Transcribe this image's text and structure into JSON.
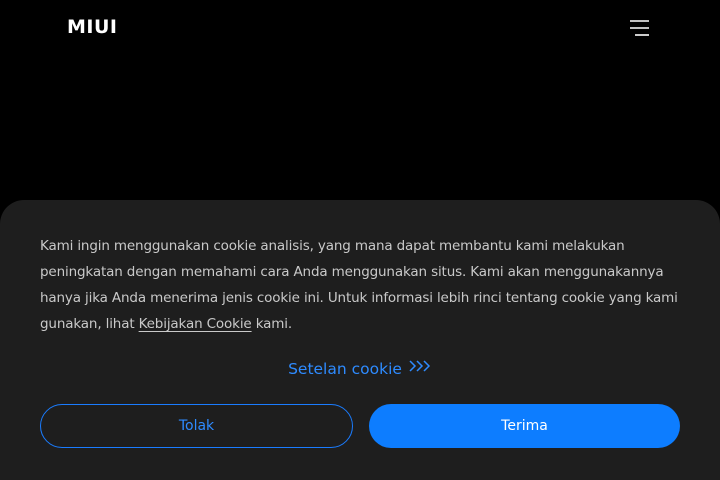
{
  "header": {
    "logo_text": "MIUI",
    "menu_icon": "hamburger-menu-icon"
  },
  "cookie_banner": {
    "message_part1": "Kami ingin menggunakan cookie analisis, yang mana dapat membantu kami melakukan peningkatan dengan memahami cara Anda menggunakan situs. Kami akan menggunakannya hanya jika Anda menerima jenis cookie ini. Untuk informasi lebih rinci tentang cookie yang kami gunakan, lihat ",
    "policy_link_label": "Kebijakan Cookie",
    "message_part2": " kami.",
    "settings_label": "Setelan cookie",
    "settings_icon": "triple-chevron-right-icon",
    "reject_label": "Tolak",
    "accept_label": "Terima"
  },
  "colors": {
    "background": "#000000",
    "panel": "#1e1e1e",
    "accent": "#0d7dff",
    "link": "#2e8bff",
    "text": "#c9c9c9"
  }
}
